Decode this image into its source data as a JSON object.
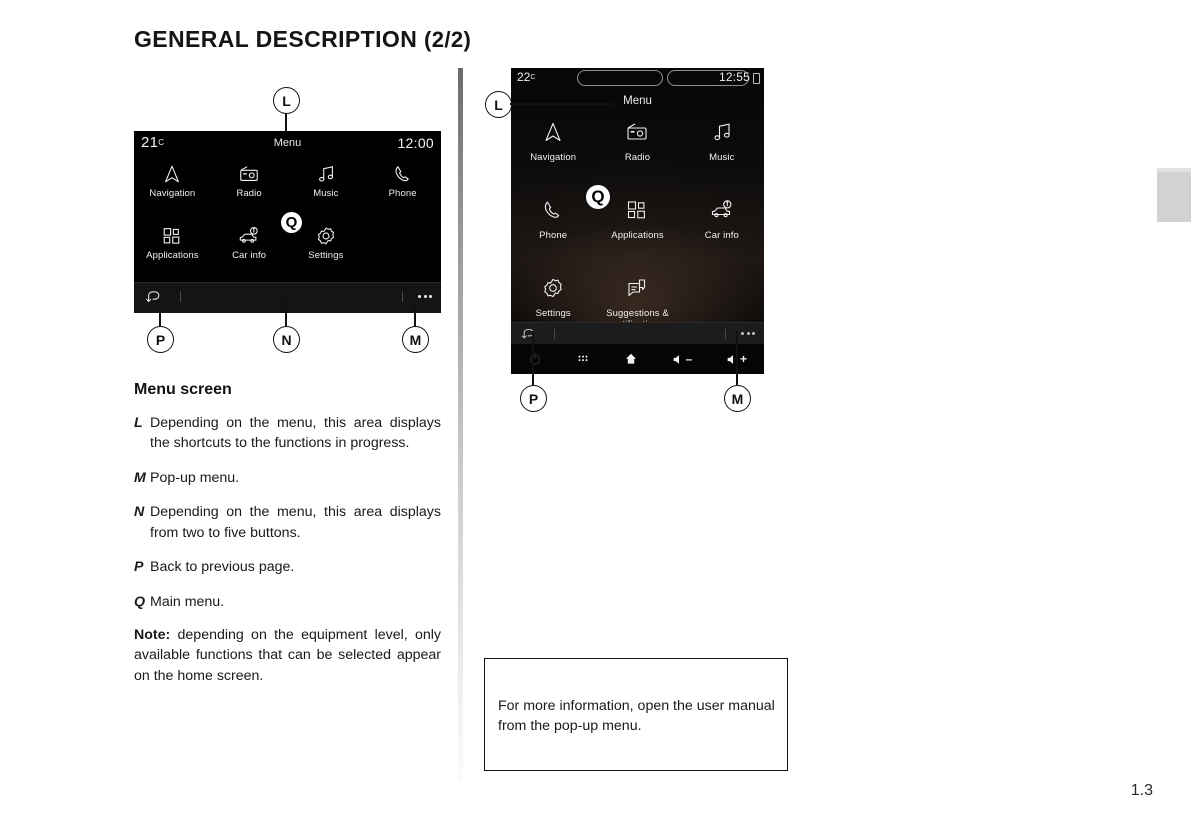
{
  "header": {
    "title": "GENERAL DESCRIPTION",
    "fraction": "(2/2)"
  },
  "page_number": "1.3",
  "left_screen": {
    "status": {
      "temperature": "21",
      "temperature_unit": "C",
      "title": "Menu",
      "clock": "12:00"
    },
    "menu_items": [
      {
        "label": "Navigation",
        "icon": "navigation-arrow-icon"
      },
      {
        "label": "Radio",
        "icon": "radio-icon"
      },
      {
        "label": "Music",
        "icon": "music-note-icon"
      },
      {
        "label": "Phone",
        "icon": "phone-handset-icon"
      },
      {
        "label": "Applications",
        "icon": "apps-grid-icon"
      },
      {
        "label": "Car info",
        "icon": "car-info-icon"
      },
      {
        "label": "Settings",
        "icon": "gear-icon"
      }
    ],
    "bottom_bar": {
      "back": "back-arrow-icon",
      "popup": "ellipsis-icon"
    }
  },
  "right_screen": {
    "status": {
      "temperature": "22",
      "temperature_unit": "C",
      "clock": "12:55",
      "title": "Menu"
    },
    "menu_items": [
      {
        "label": "Navigation",
        "icon": "navigation-arrow-icon"
      },
      {
        "label": "Radio",
        "icon": "radio-icon"
      },
      {
        "label": "Music",
        "icon": "music-note-icon"
      },
      {
        "label": "Phone",
        "icon": "phone-handset-icon"
      },
      {
        "label": "Applications",
        "icon": "apps-grid-icon"
      },
      {
        "label": "Car info",
        "icon": "car-info-icon"
      },
      {
        "label": "Settings",
        "icon": "gear-icon"
      },
      {
        "label": "Suggestions & notifications",
        "icon": "suggestions-icon"
      }
    ],
    "bottom_bar": {
      "back": "back-arrow-icon",
      "popup": "ellipsis-icon"
    },
    "hardware_buttons": [
      {
        "name": "power-button",
        "icon": "power-icon",
        "label": ""
      },
      {
        "name": "apps-button",
        "icon": "apps-grid-icon",
        "label": ""
      },
      {
        "name": "home-button",
        "icon": "home-icon",
        "label": ""
      },
      {
        "name": "volume-down-button",
        "icon": "speaker-icon",
        "label": "–"
      },
      {
        "name": "volume-up-button",
        "icon": "speaker-icon",
        "label": "+"
      }
    ]
  },
  "callouts": {
    "left_L": "L",
    "left_P": "P",
    "left_N": "N",
    "left_M": "M",
    "left_Q": "Q",
    "right_L": "L",
    "right_P": "P",
    "right_M": "M",
    "right_Q": "Q"
  },
  "body": {
    "section_title": "Menu screen",
    "items": [
      {
        "key": "L",
        "text": "Depending on the menu, this area displays the shortcuts to the functions in progress."
      },
      {
        "key": "M",
        "text": "Pop-up menu."
      },
      {
        "key": "N",
        "text": "Depending on the menu, this area displays from two to five buttons."
      },
      {
        "key": "P",
        "text": "Back to previous page."
      },
      {
        "key": "Q",
        "text": "Main menu."
      }
    ],
    "note_label": "Note:",
    "note_text": " depending on the equipment level, only available functions that can be selected appear on the home screen."
  },
  "info_box": {
    "text": "For more information, open the user manual from the pop-up menu."
  },
  "colors": {
    "screen_bg": "#000000",
    "screen_text": "#f0f0f0",
    "page_text": "#1a1a1a",
    "edge_tab": "#d2d2d2"
  }
}
